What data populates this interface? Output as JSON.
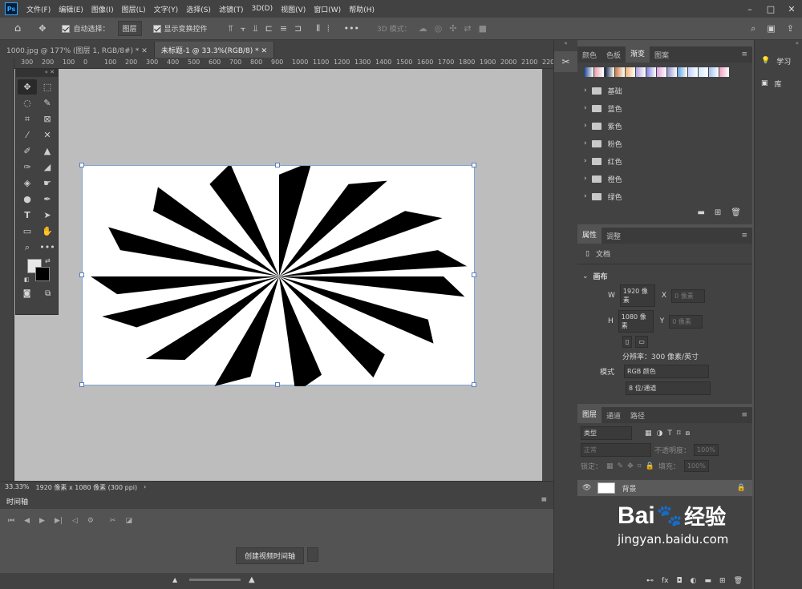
{
  "menubar": {
    "logo": "Ps",
    "items": [
      "文件(F)",
      "编辑(E)",
      "图像(I)",
      "图层(L)",
      "文字(Y)",
      "选择(S)",
      "滤镜(T)",
      "3D(D)",
      "视图(V)",
      "窗口(W)",
      "帮助(H)"
    ]
  },
  "options": {
    "auto_select_label": "自动选择：",
    "auto_select_value": "图层",
    "show_transform_label": "显示变换控件",
    "mode3d_label": "3D 模式："
  },
  "tabs": [
    "1000.jpg @ 177% (图层 1, RGB/8#) *",
    "未标题-1 @ 33.3%(RGB/8) *"
  ],
  "ruler": [
    "300",
    "200",
    "100",
    "0",
    "100",
    "200",
    "300",
    "400",
    "500",
    "600",
    "700",
    "800",
    "900",
    "1000",
    "1100",
    "1200",
    "1300",
    "1400",
    "1500",
    "1600",
    "1700",
    "1800",
    "1900",
    "2000",
    "2100",
    "2200"
  ],
  "status": {
    "zoom": "33.33%",
    "info": "1920 像素 x 1080 像素 (300 ppi)"
  },
  "timeline": {
    "title": "时间轴",
    "create_btn": "创建视频时间轴"
  },
  "swatch_panel": {
    "tabs": [
      "颜色",
      "色板",
      "渐变",
      "图案"
    ],
    "active": "渐变",
    "folders": [
      "基础",
      "蓝色",
      "紫色",
      "粉色",
      "红色",
      "橙色",
      "绿色"
    ],
    "colors": [
      "#1b3d8a",
      "#e8a0b0",
      "#0e1f3c",
      "#c87a40",
      "#f0b070",
      "#b0a0e0",
      "#8080e0",
      "#e0a0e0",
      "#9090d0",
      "#60a0e0",
      "#c0d0ff",
      "#d0e8ff",
      "#a0c0f0",
      "#f0a0c0"
    ]
  },
  "properties": {
    "tabs": [
      "属性",
      "调整"
    ],
    "doc_label": "文档",
    "canvas_label": "画布",
    "w_label": "W",
    "w_value": "1920 像素",
    "h_label": "H",
    "h_value": "1080 像素",
    "x_label": "X",
    "x_value": "0 像素",
    "y_label": "Y",
    "y_value": "0 像素",
    "resolution": "分辨率：300 像素/英寸",
    "mode_label": "模式",
    "mode_value": "RGB 颜色",
    "bits_value": "8 位/通道"
  },
  "layers": {
    "tabs": [
      "图层",
      "通道",
      "路径"
    ],
    "filter_placeholder": "类型",
    "blend": "正常",
    "opacity_label": "不透明度：",
    "opacity_value": "100%",
    "lock_label": "锁定：",
    "fill_label": "填充：",
    "fill_value": "100%",
    "layer_name": "背景"
  },
  "far_right": {
    "learn": "学习",
    "library": "库"
  },
  "watermark": {
    "brand": "Bai",
    "brand2": "经验",
    "url": "jingyan.baidu.com"
  }
}
